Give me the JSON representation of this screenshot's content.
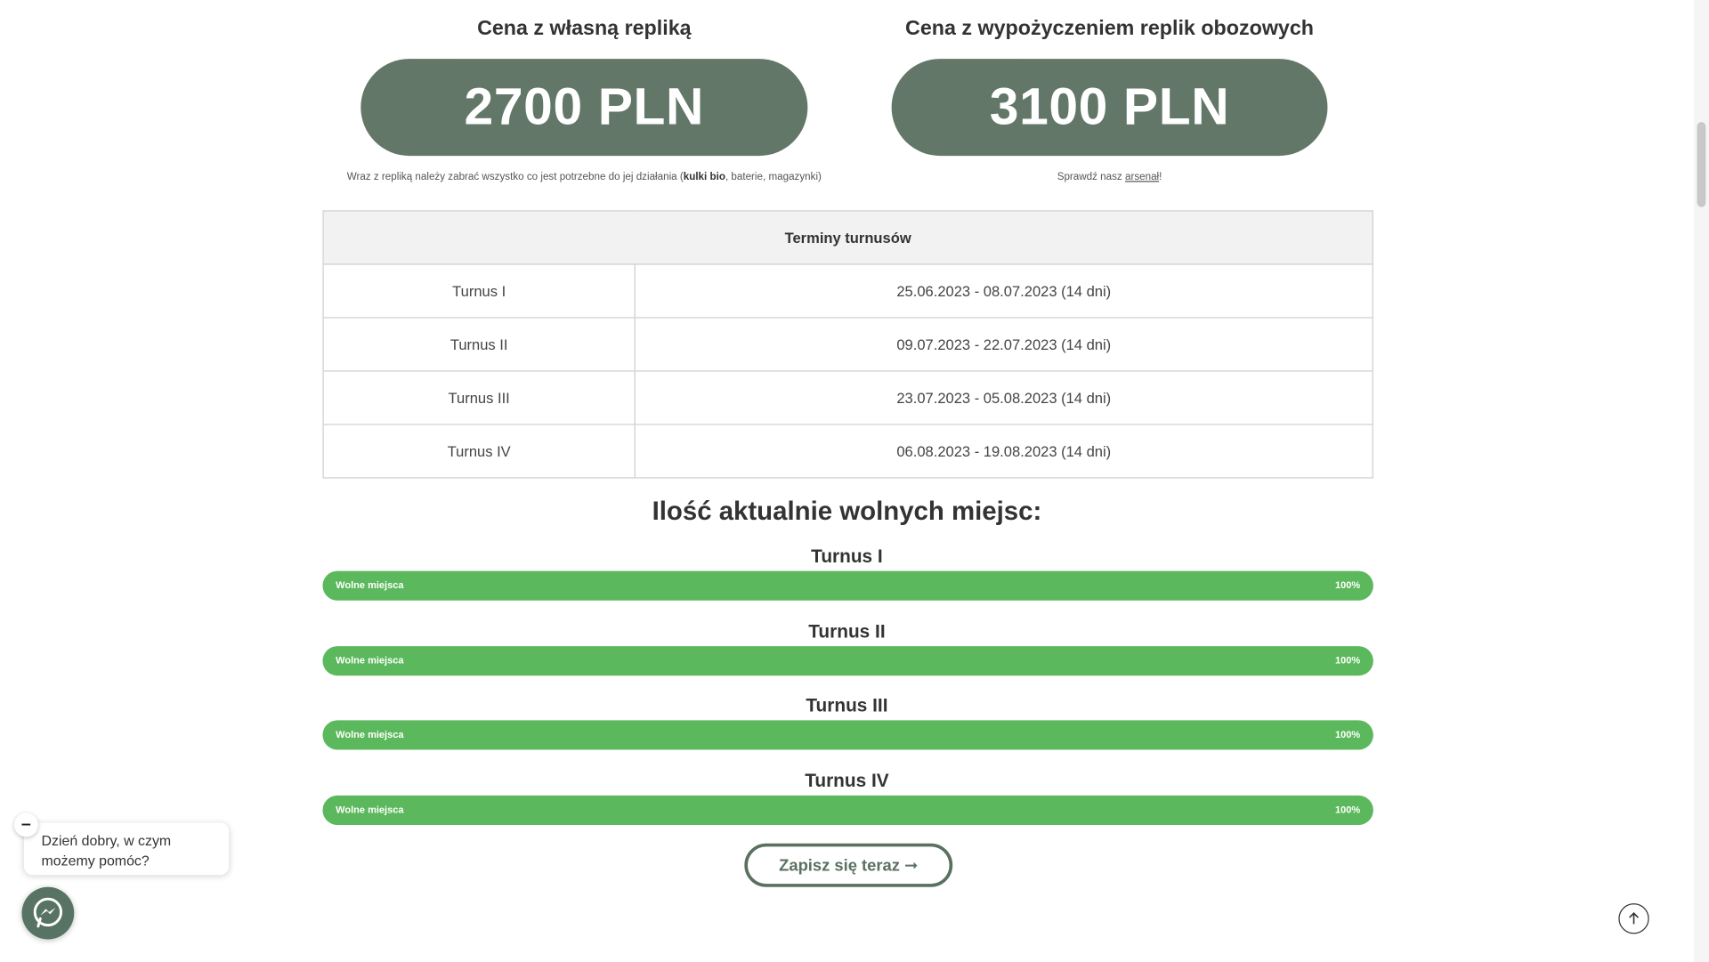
{
  "prices": [
    {
      "heading": "Cena z własną repliką",
      "amount": "2700 PLN"
    },
    {
      "heading": "Cena z wypożyczeniem replik obozowych",
      "amount": "3100 PLN"
    }
  ],
  "notes": {
    "left_pre": "Wraz z repliką należy zabrać wszystko co jest potrzebne do jej działania (",
    "left_bold": "kulki bio",
    "left_post": ", baterie, magazynki)",
    "right_pre": "Sprawdź nasz ",
    "right_link": "arsenał",
    "right_post": "!"
  },
  "terms": {
    "header": "Terminy turnusów",
    "rows": [
      {
        "name": "Turnus I",
        "dates": "25.06.2023 - 08.07.2023 (14 dni)"
      },
      {
        "name": "Turnus II",
        "dates": "09.07.2023 - 22.07.2023 (14 dni)"
      },
      {
        "name": "Turnus III",
        "dates": "23.07.2023 - 05.08.2023 (14 dni)"
      },
      {
        "name": "Turnus IV",
        "dates": "06.08.2023 - 19.08.2023 (14 dni)"
      }
    ]
  },
  "availability": {
    "heading": "Ilość aktualnie wolnych miejsc:",
    "items": [
      {
        "title": "Turnus I",
        "label": "Wolne miejsca",
        "percent": "100%",
        "fill": 1.0
      },
      {
        "title": "Turnus II",
        "label": "Wolne miejsca",
        "percent": "100%",
        "fill": 1.0
      },
      {
        "title": "Turnus III",
        "label": "Wolne miejsca",
        "percent": "100%",
        "fill": 1.0
      },
      {
        "title": "Turnus IV",
        "label": "Wolne miejsca",
        "percent": "100%",
        "fill": 1.0
      }
    ]
  },
  "cta": {
    "label": "Zapisz się teraz ➞"
  },
  "chat": {
    "greeting_line1": "Dzień dobry, w czym",
    "greeting_line2": "możemy pomóc?",
    "close": "–"
  },
  "icons": {
    "messenger": "messenger-icon",
    "scroll_top": "arrow-up-icon"
  },
  "colors": {
    "pill": "#627767",
    "bar": "#5cb85c",
    "cta": "#5a7160"
  }
}
